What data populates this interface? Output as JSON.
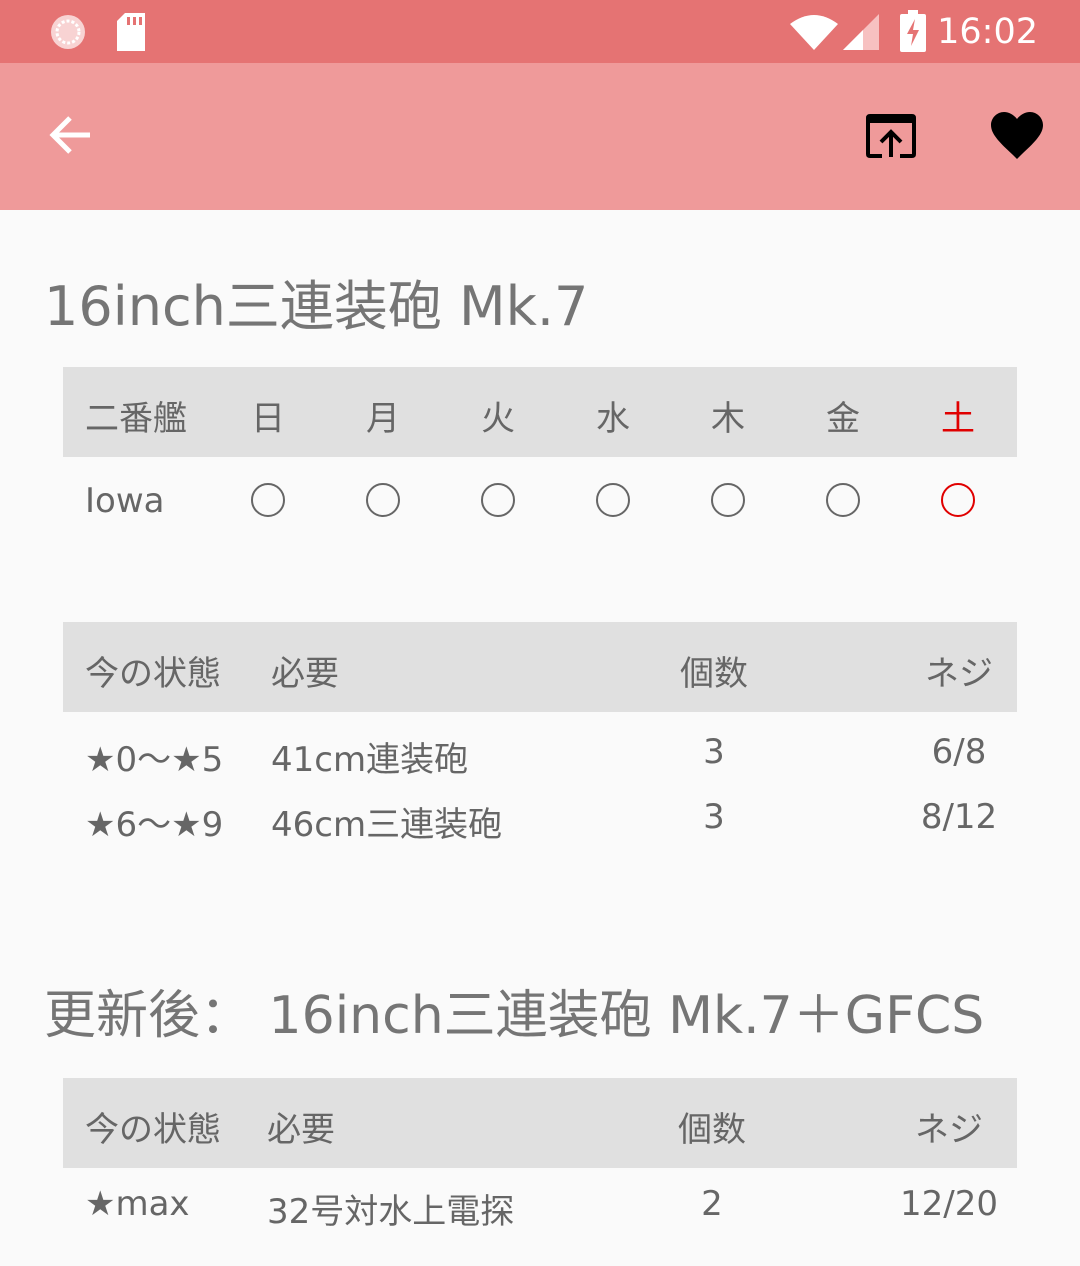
{
  "status_bar": {
    "time": "16:02",
    "icons": [
      "app-icon",
      "sd-card-icon",
      "wifi-icon",
      "cell-signal-icon",
      "battery-charging-icon"
    ]
  },
  "app_bar": {
    "back_icon": "arrow-left-icon",
    "open_icon": "open-in-browser-icon",
    "favorite_icon": "heart-icon"
  },
  "colors": {
    "status_bar": "#e57373",
    "app_bar": "#ef9a9a",
    "text": "#666666",
    "header_bg": "#e0e0e0",
    "highlight_red": "#e00000"
  },
  "item_title": "16inch三連装砲 Mk.7",
  "schedule": {
    "header": [
      "二番艦",
      "日",
      "月",
      "火",
      "水",
      "木",
      "金",
      "土"
    ],
    "rows": [
      {
        "ship": "Iowa",
        "marks": [
          "○",
          "○",
          "○",
          "○",
          "○",
          "○",
          "○"
        ]
      }
    ]
  },
  "requirements": {
    "header": [
      "今の状態",
      "必要",
      "個数",
      "ネジ"
    ],
    "rows": [
      [
        "★0〜★5",
        "41cm連装砲",
        "3",
        "6/8"
      ],
      [
        "★6〜★9",
        "46cm三連装砲",
        "3",
        "8/12"
      ]
    ]
  },
  "upgrade_title": "更新後： 16inch三連装砲 Mk.7＋GFCS",
  "upgrade": {
    "header": [
      "今の状態",
      "必要",
      "個数",
      "ネジ"
    ],
    "rows": [
      [
        "★max",
        "32号対水上電探",
        "2",
        "12/20"
      ]
    ]
  }
}
